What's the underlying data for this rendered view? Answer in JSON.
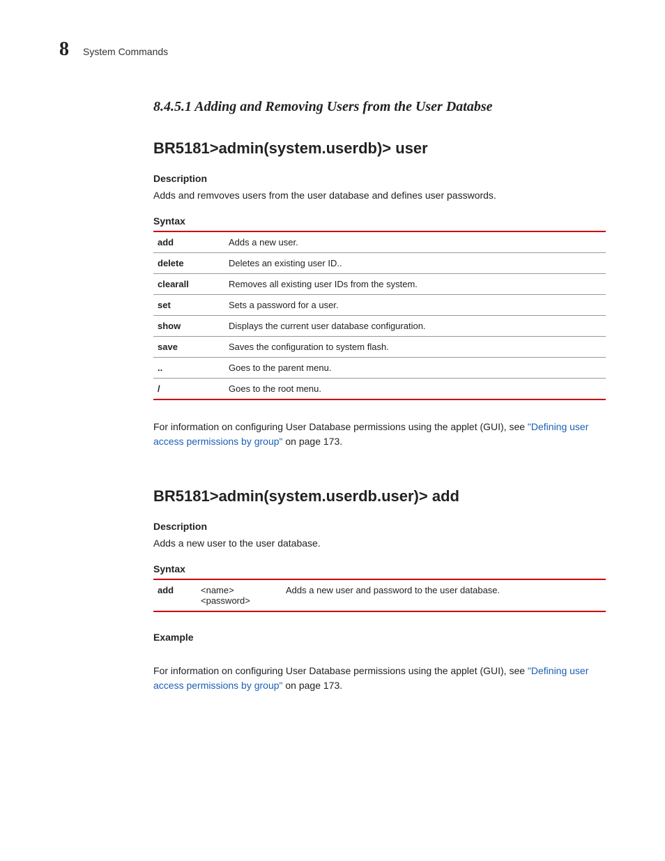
{
  "header": {
    "chapter_number": "8",
    "chapter_title": "System Commands"
  },
  "section": {
    "number_title": "8.4.5.1 Adding and Removing Users from the User Databse"
  },
  "block1": {
    "command": "BR5181>admin(system.userdb)> user",
    "desc_label": "Description",
    "desc_text": "Adds and remvoves users from the user database and defines user passwords.",
    "syntax_label": "Syntax",
    "rows": [
      {
        "cmd": "add",
        "desc": "Adds a new user."
      },
      {
        "cmd": "delete",
        "desc": "Deletes an existing user ID.."
      },
      {
        "cmd": "clearall",
        "desc": "Removes all existing user IDs from the system."
      },
      {
        "cmd": "set",
        "desc": "Sets a password for a user."
      },
      {
        "cmd": "show",
        "desc": "Displays the current user database configuration."
      },
      {
        "cmd": "save",
        "desc": "Saves the configuration to system flash."
      },
      {
        "cmd": "..",
        "desc": "Goes to the parent menu."
      },
      {
        "cmd": "/",
        "desc": "Goes to the root menu."
      }
    ],
    "footer_pre": "For information on configuring User Database permissions using the applet (GUI), see ",
    "footer_link": "\"Defining user access permissions by group\"",
    "footer_post": " on page 173."
  },
  "block2": {
    "command": "BR5181>admin(system.userdb.user)> add",
    "desc_label": "Description",
    "desc_text": "Adds a new user to the user database.",
    "syntax_label": "Syntax",
    "rows": [
      {
        "cmd": "add",
        "param": "<name> <password>",
        "desc": "Adds a new user and password to the user database."
      }
    ],
    "example_label": "Example",
    "footer_pre": "For information on configuring User Database permissions using the applet (GUI), see ",
    "footer_link": "\"Defining user access permissions by group\"",
    "footer_post": " on page 173."
  }
}
